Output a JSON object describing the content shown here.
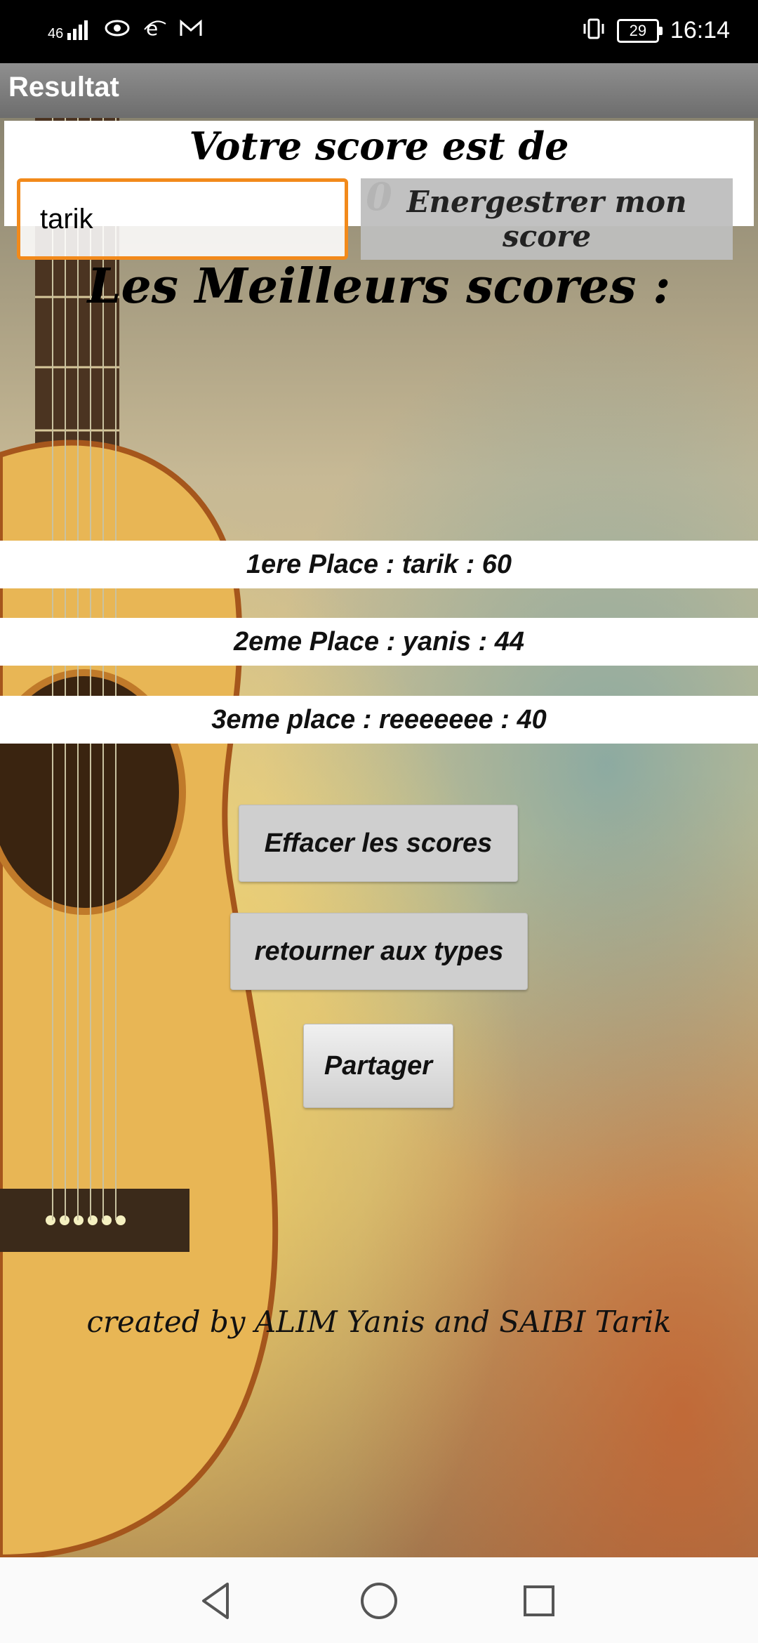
{
  "status_bar": {
    "network": "46",
    "battery": "29",
    "time": "16:14"
  },
  "app_bar": {
    "title": "Resultat"
  },
  "score": {
    "line1": "Votre score est de",
    "value": "0"
  },
  "name_input": {
    "value": "tarik"
  },
  "save_button": {
    "label": "Energestrer mon score"
  },
  "best_scores": {
    "title": "Les Meilleurs scores :",
    "entries": [
      {
        "text": "1ere Place :  tarik : 60"
      },
      {
        "text": "2eme Place : yanis : 44"
      },
      {
        "text": "3eme place : reeeeeee : 40"
      }
    ]
  },
  "buttons": {
    "clear": "Effacer les scores",
    "back": "retourner aux types",
    "share": "Partager"
  },
  "credits": "created by ALIM Yanis and SAIBI Tarik",
  "nav": {
    "back_icon": "back-triangle-icon",
    "home_icon": "home-circle-icon",
    "recents_icon": "recents-square-icon"
  }
}
